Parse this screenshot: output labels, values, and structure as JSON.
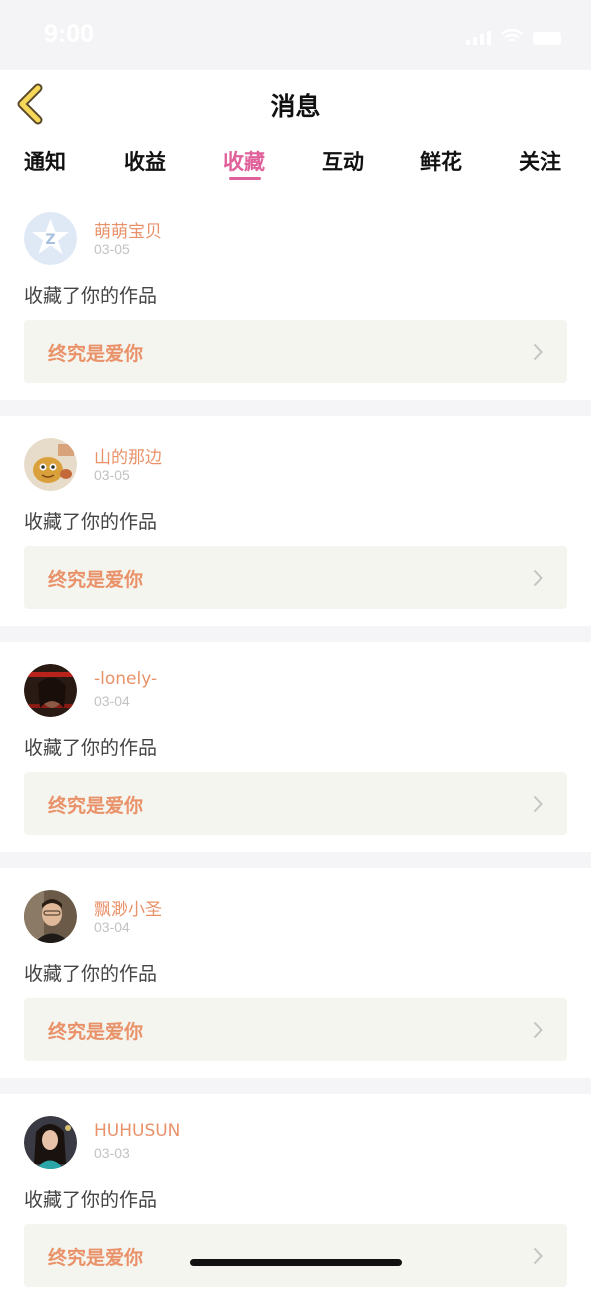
{
  "status_bar": {
    "time": "9:00"
  },
  "header": {
    "title": "消息"
  },
  "tabs": [
    {
      "label": "通知"
    },
    {
      "label": "收益"
    },
    {
      "label": "收藏",
      "active": true
    },
    {
      "label": "互动"
    },
    {
      "label": "鲜花"
    },
    {
      "label": "关注"
    }
  ],
  "colors": {
    "accent": "#e0609a",
    "username": "#e9926a",
    "work_bg": "#f5f5ef",
    "back_icon": "#f5d75a"
  },
  "feed": [
    {
      "username": "萌萌宝贝",
      "date": "03-05",
      "action": "收藏了你的作品",
      "work_title": "终究是爱你",
      "avatar": "qq-default-avatar"
    },
    {
      "username": "山的那边",
      "date": "03-05",
      "action": "收藏了你的作品",
      "work_title": "终究是爱你",
      "avatar": "cartoon-avatar"
    },
    {
      "username": "-lonely-",
      "date": "03-04",
      "action": "收藏了你的作品",
      "work_title": "终究是爱你",
      "avatar": "portrait-avatar"
    },
    {
      "username": "飘渺小圣",
      "date": "03-04",
      "action": "收藏了你的作品",
      "work_title": "终究是爱你",
      "avatar": "portrait-avatar"
    },
    {
      "username": "HUHUSUN",
      "date": "03-03",
      "action": "收藏了你的作品",
      "work_title": "终究是爱你",
      "avatar": "portrait-avatar"
    }
  ]
}
